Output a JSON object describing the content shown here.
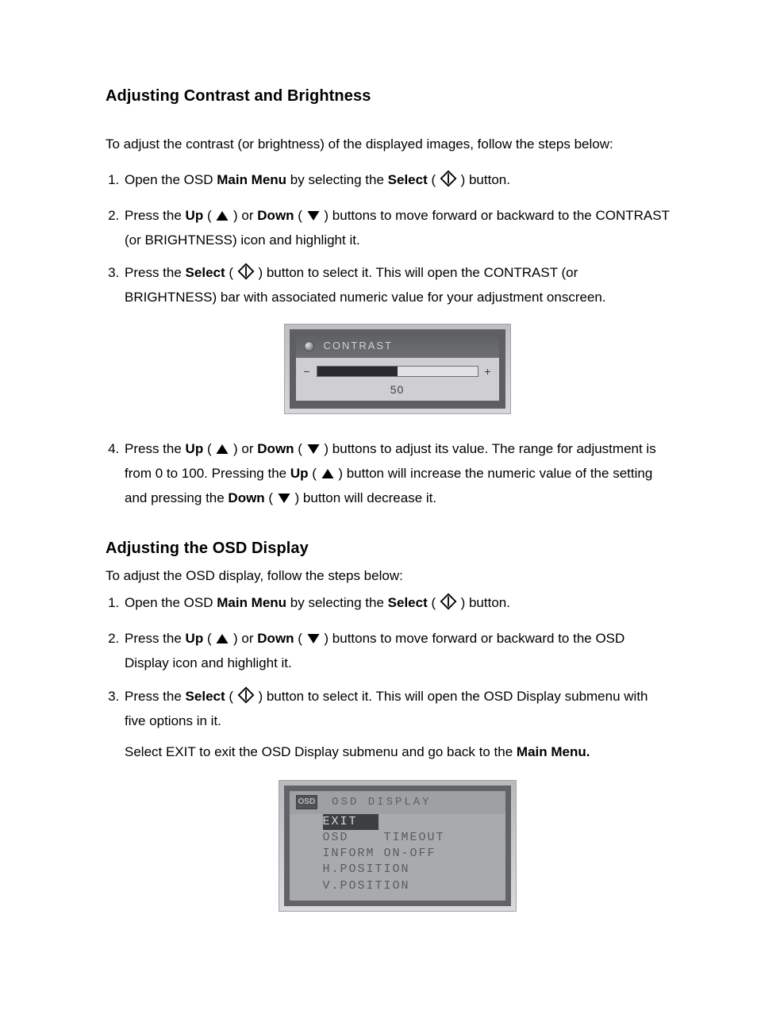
{
  "section1": {
    "heading": "Adjusting Contrast and Brightness",
    "intro": "To adjust the contrast (or brightness) of the displayed images, follow the steps below:",
    "steps": {
      "s1": {
        "t1": "Open the OSD ",
        "b1": "Main Menu",
        "t2": " by selecting the ",
        "b2": "Select",
        "t3": " ( ",
        "t4": " ) button."
      },
      "s2": {
        "t1": "Press the ",
        "b1": "Up",
        "t2": " ( ",
        "t3": " ) or ",
        "b2": "Down",
        "t4": " ( ",
        "t5": " ) buttons to move forward or backward to the CONTRAST (or BRIGHTNESS) icon and highlight it."
      },
      "s3": {
        "t1": "Press the ",
        "b1": "Select",
        "t2": " ( ",
        "t3": " ) button to select it. This will open the CONTRAST (or BRIGHTNESS) bar with associated numeric value for your adjustment onscreen."
      },
      "s4": {
        "t1": "Press the ",
        "b1": "Up",
        "t2": " ( ",
        "t3": " ) or ",
        "b2": "Down",
        "t4": " ( ",
        "t5": " ) buttons to adjust its value. The range for adjustment is from 0 to 100. Pressing the ",
        "b3": "Up",
        "t6": " ( ",
        "t7": " ) button will increase the numeric value of the setting and pressing the ",
        "b4": "Down",
        "t8": " ( ",
        "t9": " ) button will decrease it."
      }
    },
    "panel": {
      "title": "CONTRAST",
      "minus": "−",
      "plus": "+",
      "value": "50",
      "fill_percent": 50
    }
  },
  "section2": {
    "heading": "Adjusting the OSD Display",
    "intro": "To adjust the OSD display, follow the steps below:",
    "steps": {
      "s1": {
        "t1": "Open the OSD ",
        "b1": "Main Menu",
        "t2": " by selecting the ",
        "b2": "Select",
        "t3": " ( ",
        "t4": " ) button."
      },
      "s2": {
        "t1": "Press the ",
        "b1": "Up",
        "t2": " ( ",
        "t3": " ) or ",
        "b2": "Down",
        "t4": " ( ",
        "t5": " ) buttons to move forward or backward to the OSD Display icon and highlight it."
      },
      "s3": {
        "t1": "Press the ",
        "b1": "Select",
        "t2": " ( ",
        "t3": " ) button to select it. This will open the OSD Display submenu with five options in it."
      }
    },
    "extra": {
      "t1": "Select EXIT to exit the OSD Display submenu and go back to the ",
      "b1": "Main Menu.",
      "t2": ""
    },
    "panel": {
      "badge": "OSD",
      "title": "OSD DISPLAY",
      "items": {
        "i0": "EXIT",
        "i1": "OSD    TIMEOUT",
        "i2": "INFORM ON-OFF",
        "i3": "H.POSITION",
        "i4": "V.POSITION"
      },
      "highlight_index": 0
    }
  }
}
